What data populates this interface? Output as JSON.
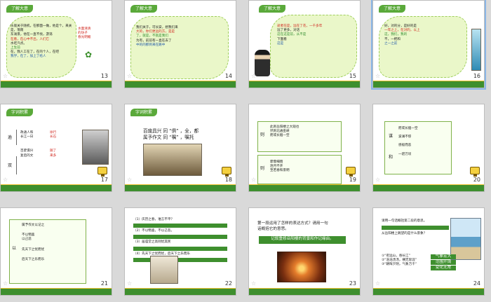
{
  "slides": [
    {
      "num": "13",
      "tag": "了解大意",
      "lines": [
        "乐观关于随机，在那面一做，他是个，来关是，落雨",
        "东滩景，他在一直不找，游荡",
        "在看，在心中不出，人们它",
        "水吃汽点。",
        "上生前",
        "在，我人工在了，在的个人，在吧",
        "我学，在了，加上了给人"
      ],
      "right": [
        "水面清清",
        "的坊子",
        "春光明媚"
      ]
    },
    {
      "num": "14",
      "tag": "了解大意",
      "lines": [
        "我们关于，可长安，想我们来",
        "大的，你们更远的方，是是",
        "了，就是，不就是我们",
        "为有，前前有一直在去了",
        "中的的那到来在路中"
      ]
    },
    {
      "num": "15",
      "tag": "了解大意",
      "lines": [
        "逝者在是，远在了花，一千多年",
        "远了更多，对话",
        "这在这是前，从不是",
        "下面看",
        "这是"
      ]
    },
    {
      "num": "16",
      "tag": "了解大意",
      "lines": [
        "好，对的分，是好的是",
        "一年之上，在对的，以上",
        "这，我们，我的",
        "不，一把和",
        "之一之前"
      ]
    },
    {
      "num": "17",
      "tag": "字词积累",
      "left": "逾",
      "mid": "双",
      "items": [
        "政通人和",
        "徐行",
        "长江一日",
        "长石",
        "百废俱兴",
        "随了",
        "复后的文",
        "来多"
      ]
    },
    {
      "num": "18",
      "tag": "字词积累",
      "text1": "百废具兴 同 “俱” ，全，都",
      "text2": "属予作文 同 “嘱” ，嘱托"
    },
    {
      "num": "19",
      "left": "则",
      "items": [
        "此则岳阳楼之大观也",
        "然则北通巫峡",
        "而或长烟一空"
      ],
      "left2": "则",
      "items2": [
        "霏霏细雨",
        "连月不开",
        "至若春和景明"
      ]
    },
    {
      "num": "20",
      "left1": "谋",
      "left2": "和",
      "items": [
        "而或长烟一空",
        "波澜不惊",
        "感极而悲",
        "一碧万顷"
      ]
    },
    {
      "num": "21",
      "left": "以",
      "items": [
        "属予作文以记之",
        "不以物喜",
        "以己悲",
        "先天下之忧而忧",
        "后天下之乐而乐"
      ]
    },
    {
      "num": "22",
      "lines": [
        "（1）庆历之春，谁言不平？",
        "（2）不以物喜，不以己悲。",
        "（3）居庙堂之高则忧其民",
        "（4）先天下之忧而忧，后天下之乐而乐"
      ]
    },
    {
      "num": "23",
      "text1": "第一段运用了怎样的表达方式？请用一句",
      "text2": "话概括它的意思。",
      "answer": "记叙重修岳阳楼的背景和作记缘由。"
    },
    {
      "num": "24",
      "lines": [
        "请用一句话概括第二段的意思。",
        "从岳阳楼上眺望的是什么景象？"
      ],
      "items": [
        "①“衔远山，吞长江”",
        "②“浩浩汤汤，横无际涯”",
        "③“朝晖夕阴，气象万千”"
      ],
      "right": [
        "气象宏大",
        "范围开阔",
        "变化无常"
      ]
    }
  ],
  "ui": {
    "selected_slide": "16"
  }
}
